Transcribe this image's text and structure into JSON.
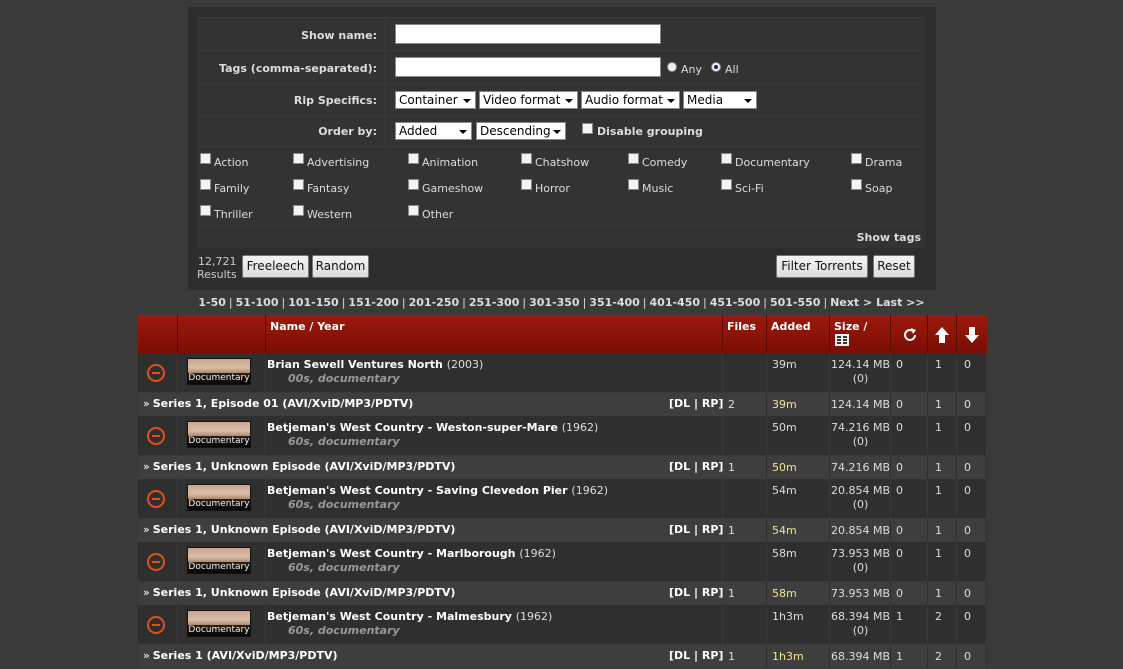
{
  "form": {
    "show_name_label": "Show name:",
    "tags_label": "Tags (comma-separated):",
    "tags_any": "Any",
    "tags_all": "All",
    "rip_label": "Rip Specifics:",
    "rip_selects": [
      "Container",
      "Video format",
      "Audio format",
      "Media"
    ],
    "order_label": "Order by:",
    "order_field": "Added",
    "order_dir": "Descending",
    "disable_grouping": "Disable grouping",
    "genres": [
      "Action",
      "Advertising",
      "Animation",
      "Chatshow",
      "Comedy",
      "Documentary",
      "Drama",
      "Family",
      "Fantasy",
      "Gameshow",
      "Horror",
      "Music",
      "Sci-Fi",
      "Soap",
      "Thriller",
      "Western",
      "Other"
    ],
    "show_tags": "Show tags",
    "results_count": "12,721",
    "results_label": "Results",
    "btn_freeleech": "Freeleech",
    "btn_random": "Random",
    "btn_filter": "Filter Torrents",
    "btn_reset": "Reset"
  },
  "pager": {
    "pages": [
      "1-50",
      "51-100",
      "101-150",
      "151-200",
      "201-250",
      "251-300",
      "301-350",
      "351-400",
      "401-450",
      "451-500",
      "501-550"
    ],
    "next": "Next >",
    "last": "Last >>"
  },
  "table": {
    "headers": {
      "name": "Name / Year",
      "files": "Files",
      "added": "Added",
      "size": "Size /"
    },
    "groups": [
      {
        "title": "Brian Sewell Ventures North",
        "year": "(2003)",
        "tags": "00s, documentary",
        "thumb_label": "Documentary",
        "added": "39m",
        "size": "124.14 MB",
        "size_sub": "(0)",
        "snatch": "0",
        "seed": "1",
        "leech": "0",
        "torrent": {
          "label": "Series 1, Episode 01 (AVI/XviD/MP3/PDTV)",
          "dl": "DL",
          "rp": "RP",
          "files": "2",
          "added": "39m",
          "size": "124.14 MB",
          "snatch": "0",
          "seed": "1",
          "leech": "0"
        }
      },
      {
        "title": "Betjeman's West Country - Weston-super-Mare",
        "year": "(1962)",
        "tags": "60s, documentary",
        "thumb_label": "Documentary",
        "added": "50m",
        "size": "74.216 MB",
        "size_sub": "(0)",
        "snatch": "0",
        "seed": "1",
        "leech": "0",
        "torrent": {
          "label": "Series 1, Unknown Episode (AVI/XviD/MP3/PDTV)",
          "dl": "DL",
          "rp": "RP",
          "files": "1",
          "added": "50m",
          "size": "74.216 MB",
          "snatch": "0",
          "seed": "1",
          "leech": "0"
        }
      },
      {
        "title": "Betjeman's West Country - Saving Clevedon Pier",
        "year": "(1962)",
        "tags": "60s, documentary",
        "thumb_label": "Documentary",
        "added": "54m",
        "size": "20.854 MB",
        "size_sub": "(0)",
        "snatch": "0",
        "seed": "1",
        "leech": "0",
        "torrent": {
          "label": "Series 1, Unknown Episode (AVI/XviD/MP3/PDTV)",
          "dl": "DL",
          "rp": "RP",
          "files": "1",
          "added": "54m",
          "size": "20.854 MB",
          "snatch": "0",
          "seed": "1",
          "leech": "0"
        }
      },
      {
        "title": "Betjeman's West Country - Marlborough",
        "year": "(1962)",
        "tags": "60s, documentary",
        "thumb_label": "Documentary",
        "added": "58m",
        "size": "73.953 MB",
        "size_sub": "(0)",
        "snatch": "0",
        "seed": "1",
        "leech": "0",
        "torrent": {
          "label": "Series 1, Unknown Episode (AVI/XviD/MP3/PDTV)",
          "dl": "DL",
          "rp": "RP",
          "files": "1",
          "added": "58m",
          "size": "73.953 MB",
          "snatch": "0",
          "seed": "1",
          "leech": "0"
        }
      },
      {
        "title": "Betjeman's West Country - Malmesbury",
        "year": "(1962)",
        "tags": "60s, documentary",
        "thumb_label": "Documentary",
        "added": "1h3m",
        "size": "68.394 MB",
        "size_sub": "(0)",
        "snatch": "1",
        "seed": "2",
        "leech": "0",
        "torrent": {
          "label": "Series 1 (AVI/XviD/MP3/PDTV)",
          "dl": "DL",
          "rp": "RP",
          "files": "1",
          "added": "1h3m",
          "size": "68.394 MB",
          "snatch": "1",
          "seed": "2",
          "leech": "0"
        }
      }
    ]
  },
  "icons": {
    "remove": "minus-circle-icon",
    "snatched": "refresh-icon",
    "seeders": "arrow-up-icon",
    "leechers": "arrow-down-icon",
    "size_sort": "sort-icon"
  },
  "colors": {
    "header_red": "#8b1409",
    "accent_orange": "#e05018",
    "added_highlight": "#f0e68c"
  }
}
